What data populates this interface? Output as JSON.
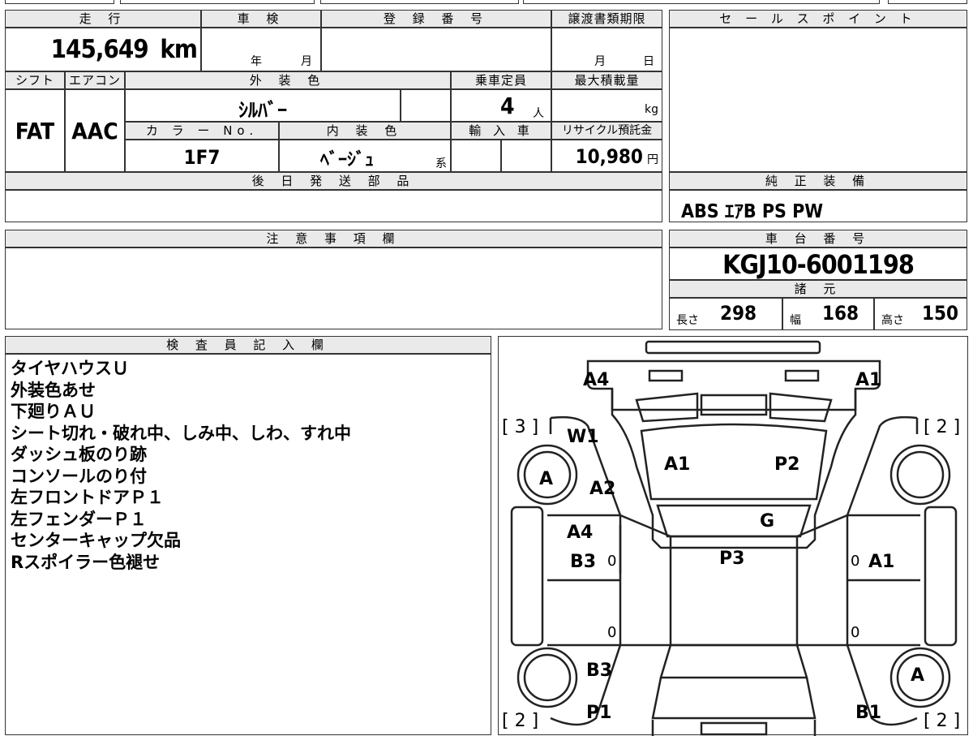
{
  "top": {
    "mileage_header": "走 行",
    "mileage": "145,649",
    "mileage_unit": "km",
    "inspection_header": "車 検",
    "inspection_year": "年",
    "inspection_month": "月",
    "reg_header": "登 録 番 号",
    "transfer_header": "譲渡書類期限",
    "transfer_month": "月",
    "transfer_day": "日"
  },
  "spec_row": {
    "shift_header": "シフト",
    "shift": "FAT",
    "ac_header": "エアコン",
    "ac": "AAC",
    "ext_color_header": "外 装 色",
    "ext_color": "ｼﾙﾊﾞｰ",
    "capacity_header": "乗車定員",
    "capacity": "4",
    "capacity_unit": "人",
    "max_load_header": "最大積載量",
    "max_load_unit": "kg",
    "color_no_header": "カ ラ ー No.",
    "color_no": "1F7",
    "int_color_header": "内 装 色",
    "int_color": "ﾍﾞｰｼﾞｭ",
    "int_color_suffix": "系",
    "import_header": "輸 入 車",
    "recycle_header": "リサイクル預託金",
    "recycle": "10,980",
    "recycle_unit": "円"
  },
  "later_parts_header": "後 日 発 送 部 品",
  "sales_point_header": "セ ー ル ス ポ イ ン ト",
  "equipment_header": "純 正 装 備",
  "equipment": "ABS ｴｱB PS PW",
  "notes_header": "注 意 事 項 欄",
  "chassis_header": "車 台 番 号",
  "chassis": "KGJ10-6001198",
  "dimensions_header": "諸 元",
  "dimensions": {
    "length_label": "長さ",
    "length": "298",
    "width_label": "幅",
    "width": "168",
    "height_label": "高さ",
    "height": "150"
  },
  "inspector_header": "検 査 員 記 入 欄",
  "inspector_notes": [
    "タイヤハウスＵ",
    "外装色あせ",
    "下廻りＡＵ",
    "シート切れ・破れ中、しみ中、しわ、すれ中",
    "ダッシュ板のり跡",
    "コンソールのり付",
    "左フロントドアＰ１",
    "左フェンダーＰ１",
    "センターキャップ欠品",
    "Rスポイラー色褪せ"
  ],
  "map": {
    "front_left": "A4",
    "front_right": "A1",
    "tire_fr": "[ 3 ]",
    "tire_fl": "[ 2 ]",
    "tire_rl": "[ 2 ]",
    "tire_rr": "[ 2 ]",
    "w1": "W1",
    "hood_left": "A1",
    "hood_right": "P2",
    "fender_left": "A2",
    "windshield": "G",
    "door_left_1": "A4",
    "door_left_2": "B3",
    "roof": "P3",
    "door_right": "A1",
    "wheel_fl": "A",
    "wheel_rr": "A",
    "rear_left_1": "B3",
    "rear_left_2": "P1",
    "rear_right": "B1",
    "zero": "0"
  }
}
